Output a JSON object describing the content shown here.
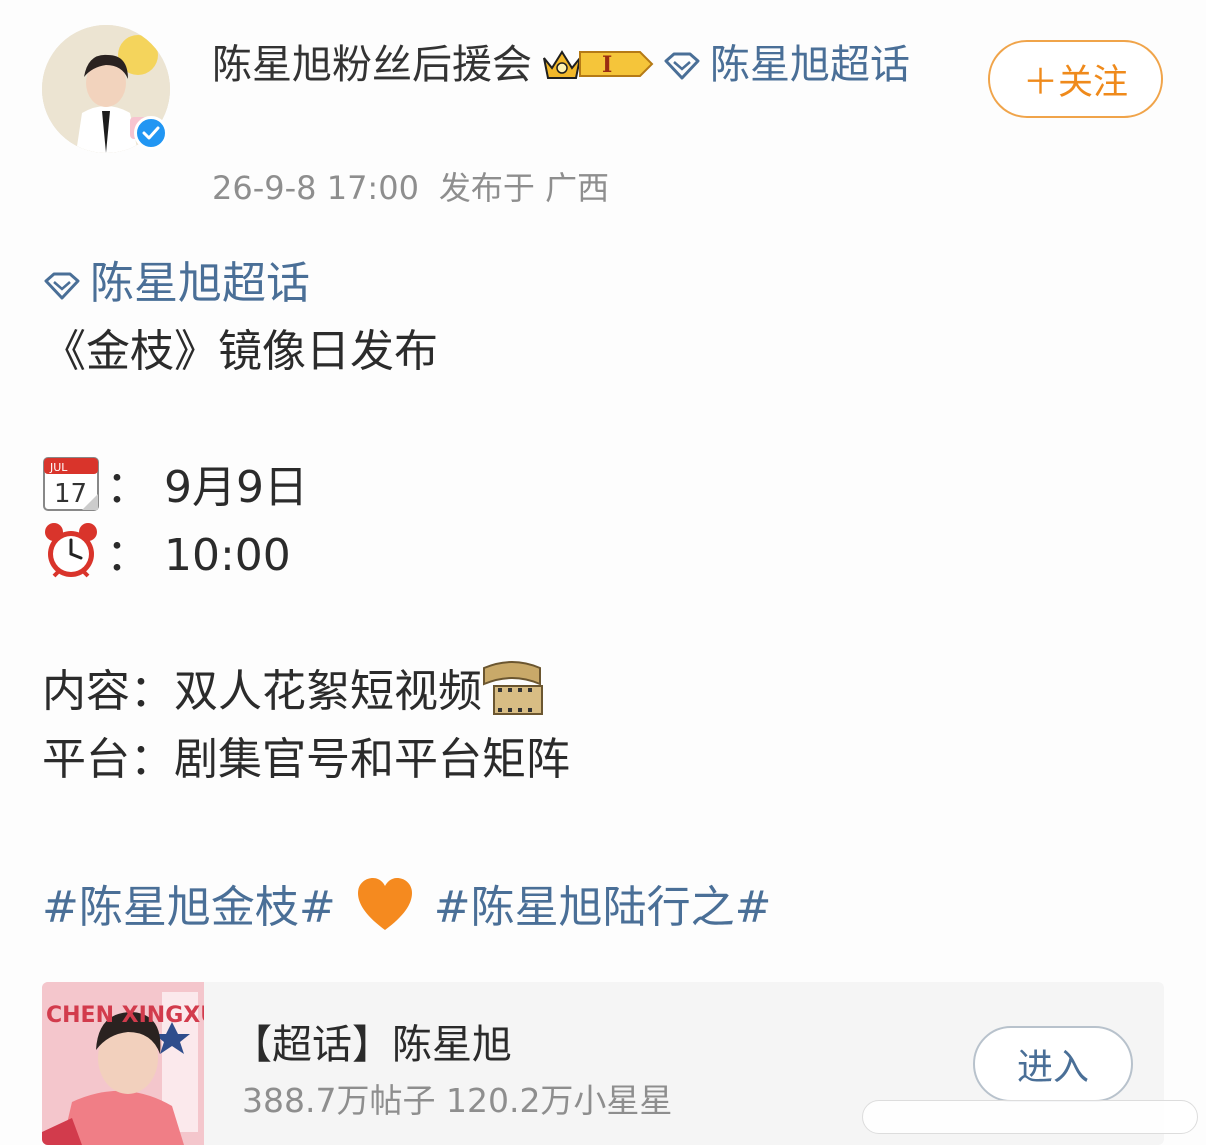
{
  "post": {
    "author": {
      "name": "陈星旭粉丝后援会",
      "topic": "陈星旭超话",
      "verified": true,
      "badge_level": "I"
    },
    "timestamp": "26-9-8 17:00",
    "location": "发布于 广西",
    "follow_label": "＋关注"
  },
  "content": {
    "topic": "陈星旭超话",
    "title": "《金枝》镜像日发布",
    "date_value": "：  9月9日",
    "time_value": "：  10:00",
    "content_label": "内容：",
    "content_value": "双人花絮短视频",
    "platform_label": "平台：",
    "platform_value": "剧集官号和平台矩阵",
    "hashtag1": "#陈星旭金枝#",
    "hashtag2": "#陈星旭陆行之#"
  },
  "card": {
    "title": "【超话】陈星旭",
    "stats": "388.7万帖子 120.2万小星星",
    "enter_label": "进入",
    "thumb_text": "CHEN XINGXU"
  },
  "colors": {
    "link": "#4a6f97",
    "follow": "#ef8a1b",
    "meta": "#8e8e8e"
  }
}
